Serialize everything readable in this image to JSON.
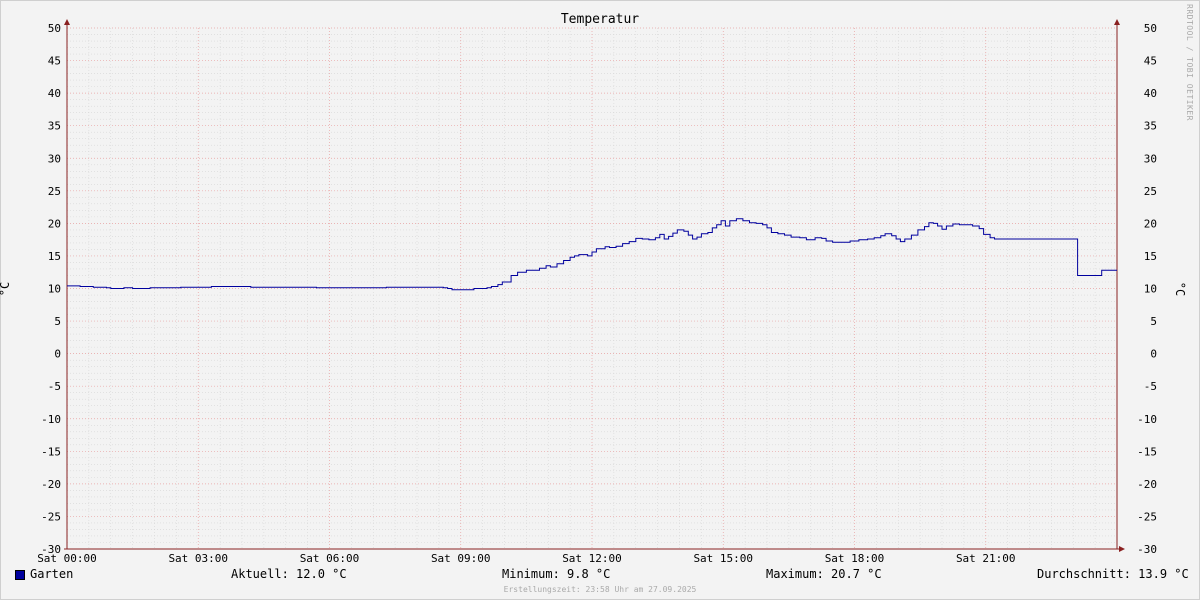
{
  "chart_data": {
    "type": "line",
    "title": "Temperatur",
    "ylabel": "°C",
    "ylabel_right": "°C",
    "ylim": [
      -30,
      50
    ],
    "y_ticks": [
      50,
      45,
      40,
      35,
      30,
      25,
      20,
      15,
      10,
      5,
      0,
      -5,
      -10,
      -15,
      -20,
      -25,
      -30
    ],
    "xlim_hours": [
      0,
      24
    ],
    "x_ticks": [
      {
        "label": "Sat 00:00",
        "hour": 0
      },
      {
        "label": "Sat 03:00",
        "hour": 3
      },
      {
        "label": "Sat 06:00",
        "hour": 6
      },
      {
        "label": "Sat 09:00",
        "hour": 9
      },
      {
        "label": "Sat 12:00",
        "hour": 12
      },
      {
        "label": "Sat 15:00",
        "hour": 15
      },
      {
        "label": "Sat 18:00",
        "hour": 18
      },
      {
        "label": "Sat 21:00",
        "hour": 21
      }
    ],
    "grid": true,
    "series": [
      {
        "name": "Garten",
        "color": "#00009e",
        "step": true,
        "points": [
          [
            0.0,
            10.4
          ],
          [
            0.3,
            10.3
          ],
          [
            0.6,
            10.2
          ],
          [
            0.9,
            10.1
          ],
          [
            1.0,
            10.0
          ],
          [
            1.3,
            10.1
          ],
          [
            1.5,
            10.0
          ],
          [
            1.9,
            10.1
          ],
          [
            2.6,
            10.2
          ],
          [
            3.2,
            10.2
          ],
          [
            3.3,
            10.3
          ],
          [
            3.9,
            10.3
          ],
          [
            4.2,
            10.2
          ],
          [
            5.0,
            10.2
          ],
          [
            5.5,
            10.2
          ],
          [
            5.7,
            10.1
          ],
          [
            6.5,
            10.1
          ],
          [
            7.0,
            10.1
          ],
          [
            7.3,
            10.2
          ],
          [
            8.2,
            10.2
          ],
          [
            8.6,
            10.1
          ],
          [
            8.7,
            10.0
          ],
          [
            8.8,
            9.8
          ],
          [
            9.1,
            9.8
          ],
          [
            9.3,
            10.0
          ],
          [
            9.6,
            10.1
          ],
          [
            9.7,
            10.3
          ],
          [
            9.85,
            10.6
          ],
          [
            9.95,
            11.0
          ],
          [
            10.1,
            11.0
          ],
          [
            10.15,
            12.0
          ],
          [
            10.3,
            12.5
          ],
          [
            10.5,
            12.8
          ],
          [
            10.6,
            12.8
          ],
          [
            10.8,
            13.1
          ],
          [
            10.95,
            13.5
          ],
          [
            11.05,
            13.3
          ],
          [
            11.2,
            13.8
          ],
          [
            11.35,
            14.3
          ],
          [
            11.5,
            14.8
          ],
          [
            11.6,
            15.0
          ],
          [
            11.7,
            15.2
          ],
          [
            11.9,
            15.0
          ],
          [
            12.0,
            15.6
          ],
          [
            12.1,
            16.1
          ],
          [
            12.3,
            16.4
          ],
          [
            12.4,
            16.3
          ],
          [
            12.55,
            16.5
          ],
          [
            12.7,
            16.9
          ],
          [
            12.85,
            17.2
          ],
          [
            13.0,
            17.7
          ],
          [
            13.15,
            17.6
          ],
          [
            13.3,
            17.5
          ],
          [
            13.45,
            17.8
          ],
          [
            13.55,
            18.3
          ],
          [
            13.65,
            17.6
          ],
          [
            13.75,
            18.0
          ],
          [
            13.85,
            18.5
          ],
          [
            13.95,
            19.0
          ],
          [
            14.1,
            18.8
          ],
          [
            14.2,
            18.2
          ],
          [
            14.3,
            17.6
          ],
          [
            14.4,
            17.9
          ],
          [
            14.5,
            18.4
          ],
          [
            14.65,
            18.6
          ],
          [
            14.75,
            19.3
          ],
          [
            14.85,
            19.8
          ],
          [
            14.95,
            20.4
          ],
          [
            15.05,
            19.6
          ],
          [
            15.15,
            20.4
          ],
          [
            15.3,
            20.7
          ],
          [
            15.45,
            20.4
          ],
          [
            15.6,
            20.1
          ],
          [
            15.75,
            20.0
          ],
          [
            15.9,
            19.8
          ],
          [
            16.0,
            19.3
          ],
          [
            16.1,
            18.6
          ],
          [
            16.25,
            18.4
          ],
          [
            16.4,
            18.2
          ],
          [
            16.55,
            17.9
          ],
          [
            16.75,
            17.8
          ],
          [
            16.9,
            17.5
          ],
          [
            17.1,
            17.8
          ],
          [
            17.25,
            17.7
          ],
          [
            17.35,
            17.3
          ],
          [
            17.5,
            17.1
          ],
          [
            17.7,
            17.1
          ],
          [
            17.9,
            17.3
          ],
          [
            18.1,
            17.5
          ],
          [
            18.3,
            17.6
          ],
          [
            18.45,
            17.8
          ],
          [
            18.6,
            18.1
          ],
          [
            18.7,
            18.4
          ],
          [
            18.85,
            18.1
          ],
          [
            18.95,
            17.6
          ],
          [
            19.05,
            17.2
          ],
          [
            19.15,
            17.6
          ],
          [
            19.3,
            18.2
          ],
          [
            19.45,
            19.0
          ],
          [
            19.6,
            19.5
          ],
          [
            19.7,
            20.1
          ],
          [
            19.8,
            20.0
          ],
          [
            19.9,
            19.6
          ],
          [
            20.0,
            19.1
          ],
          [
            20.1,
            19.6
          ],
          [
            20.25,
            19.9
          ],
          [
            20.4,
            19.8
          ],
          [
            20.55,
            19.8
          ],
          [
            20.7,
            19.6
          ],
          [
            20.85,
            19.2
          ],
          [
            20.95,
            18.3
          ],
          [
            21.0,
            18.3
          ],
          [
            21.1,
            17.8
          ],
          [
            21.2,
            17.6
          ],
          [
            22.3,
            17.6
          ],
          [
            23.0,
            17.6
          ],
          [
            23.1,
            12.0
          ],
          [
            23.6,
            12.0
          ],
          [
            23.65,
            12.8
          ],
          [
            24.0,
            12.8
          ]
        ]
      }
    ]
  },
  "legend": {
    "series_name": "Garten",
    "current": "Aktuell: 12.0 °C",
    "minimum": "Minimum: 9.8 °C",
    "maximum": "Maximum: 20.7 °C",
    "average": "Durchschnitt: 13.9 °C"
  },
  "footer": "Erstellungszeit: 23:58 Uhr am 27.09.2025",
  "watermark": "RRDTOOL / TOBI OETIKER"
}
